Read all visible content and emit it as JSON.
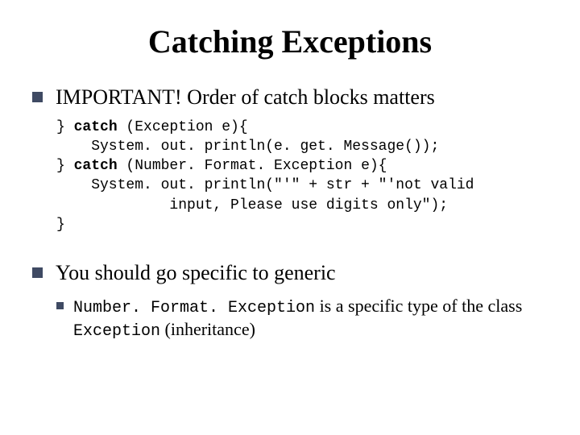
{
  "title": "Catching Exceptions",
  "bullets": {
    "b1": "IMPORTANT! Order of catch blocks matters",
    "b2": "You should go specific to generic"
  },
  "code": {
    "l1a": "} ",
    "l1kw": "catch",
    "l1b": " (Exception e){",
    "l2": "    System. out. println(e. get. Message());",
    "l3a": "} ",
    "l3kw": "catch",
    "l3b": " (Number. Format. Exception e){",
    "l4": "    System. out. println(\"'\" + str + \"'not valid",
    "l5": "             input, Please use digits only\");",
    "l6": "}"
  },
  "sub": {
    "code1": "Number. Format. Exception",
    "txt1": " is a specific type of the class ",
    "code2": "Exception",
    "txt2": " (inheritance)"
  }
}
